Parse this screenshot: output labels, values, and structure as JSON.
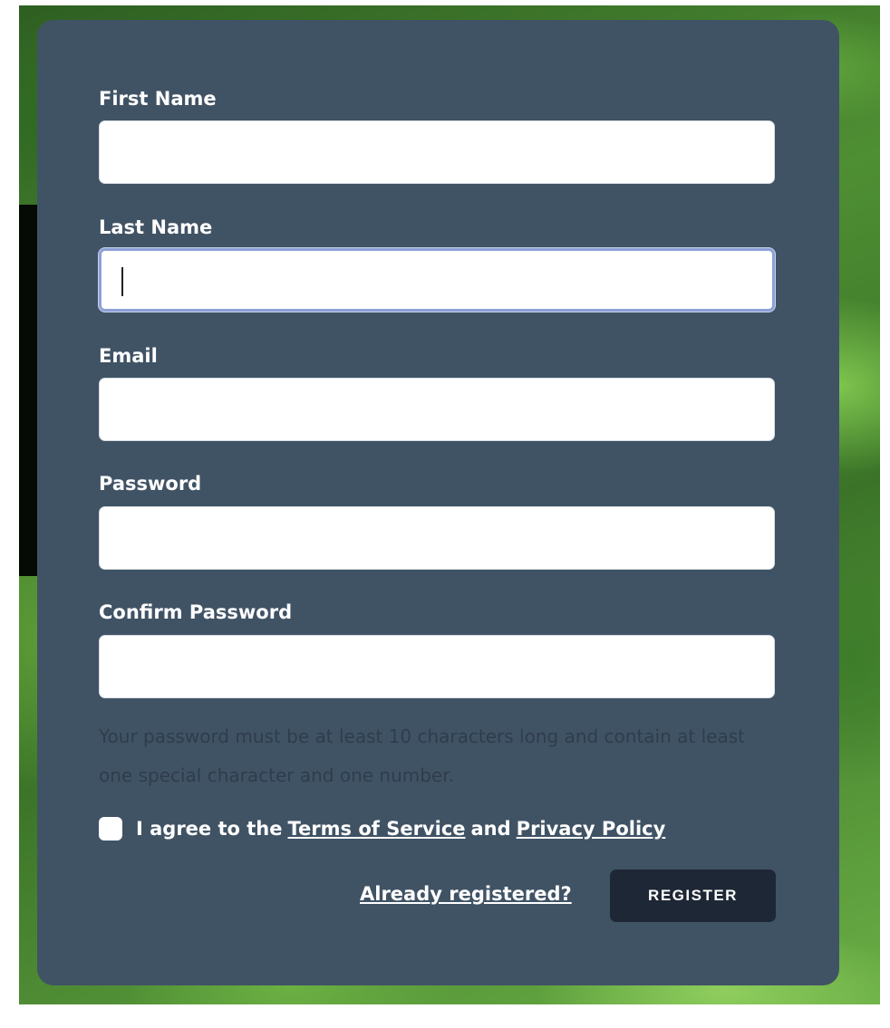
{
  "form": {
    "fields": [
      {
        "label": "First Name",
        "value": "",
        "focused": false
      },
      {
        "label": "Last Name",
        "value": "",
        "focused": true
      },
      {
        "label": "Email",
        "value": "",
        "focused": false
      },
      {
        "label": "Password",
        "value": "",
        "focused": false
      },
      {
        "label": "Confirm Password",
        "value": "",
        "focused": false
      }
    ],
    "password_hint": "Your password must be at least 10 characters long and contain at least one special character and one number.",
    "agree": {
      "checked": false,
      "prefix": "I agree to the",
      "terms_link": "Terms of Service",
      "middle": "and",
      "privacy_link": "Privacy Policy"
    },
    "already_registered_link": "Already registered?",
    "register_button": "REGISTER"
  },
  "colors": {
    "panel": "#405365",
    "button": "#1e2735",
    "focus_ring": "#8ea0d6",
    "hint_text": "#2f3d4b"
  }
}
